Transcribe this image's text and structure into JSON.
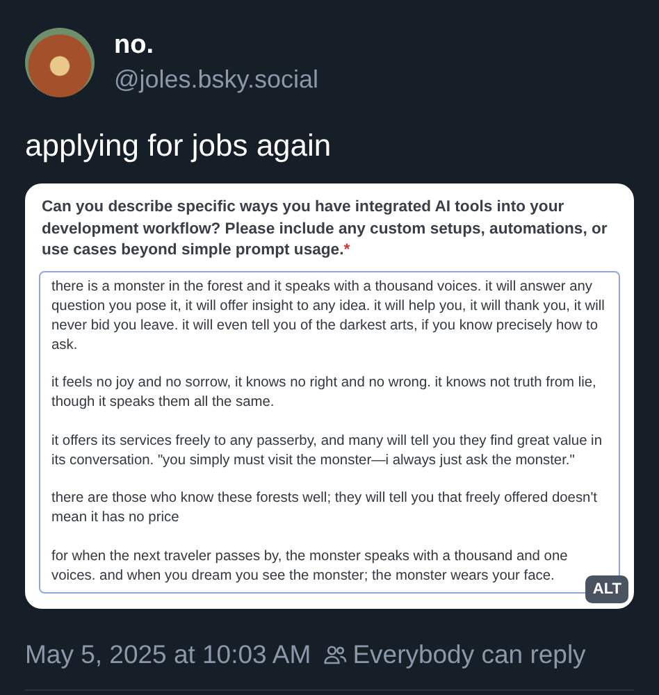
{
  "author": {
    "name": "no.",
    "handle": "@joles.bsky.social"
  },
  "post_text": "applying for jobs again",
  "image": {
    "question": "Can you describe specific ways you have integrated AI tools into your development workflow? Please include any custom setups, automations, or use cases beyond simple prompt usage.",
    "required_mark": "*",
    "answer_paragraphs": [
      "there is a monster in the forest and it speaks with a thousand voices. it will answer any question you pose it, it will offer insight to any idea. it will help you, it will thank you, it will never bid you leave. it will even tell you of the darkest arts, if you know precisely how to ask.",
      "it feels no joy and no sorrow, it knows no right and no wrong. it knows not truth from lie, though it speaks them all the same.",
      "it offers its services freely to any passerby, and many will tell you they find great value in its conversation. \"you simply must visit the monster—i always just ask the monster.\"",
      "there are those who know these forests well; they will tell you that freely offered doesn't mean it has no price",
      "for when the next traveler passes by, the monster speaks with a thousand and one voices. and when you dream you see the monster; the monster wears your face."
    ],
    "alt_badge": "ALT"
  },
  "timestamp": "May 5, 2025 at 10:03 AM",
  "reply_setting": "Everybody can reply"
}
